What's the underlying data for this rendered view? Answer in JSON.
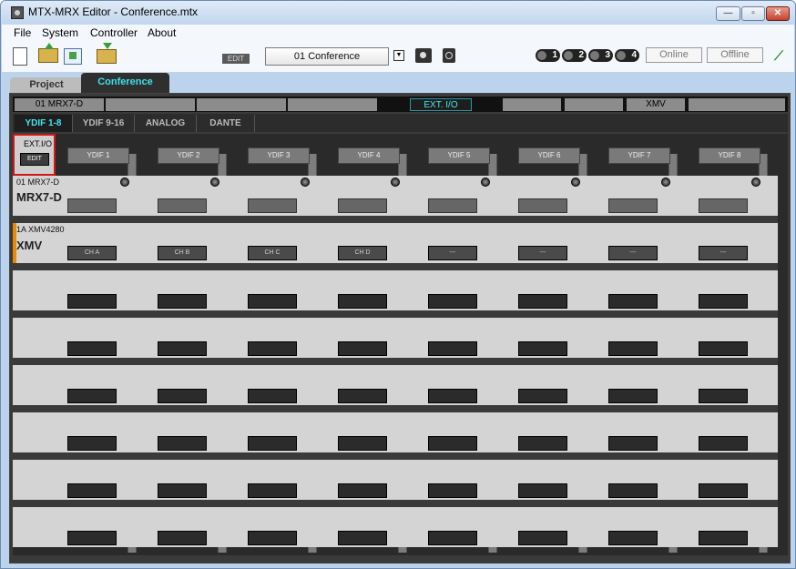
{
  "window": {
    "title": "MTX-MRX Editor - Conference.mtx"
  },
  "menu": [
    "File",
    "System",
    "Controller",
    "About"
  ],
  "toolbar": {
    "edit_label": "EDIT",
    "preset": "01 Conference",
    "leds": [
      "1",
      "2",
      "3",
      "4"
    ],
    "online": "Online",
    "offline": "Offline"
  },
  "tabs": {
    "project": "Project",
    "conference": "Conference"
  },
  "device_tabs": [
    "01 MRX7-D",
    "",
    "",
    "",
    "EXT. I/O",
    "",
    "",
    "XMV",
    ""
  ],
  "section_tabs": [
    "YDIF 1-8",
    "YDIF 9-16",
    "ANALOG",
    "DANTE"
  ],
  "ext_io": {
    "label": "EXT.I/O",
    "edit": "EDIT"
  },
  "columns": [
    "YDIF 1",
    "YDIF 2",
    "YDIF 3",
    "YDIF 4",
    "YDIF 5",
    "YDIF 6",
    "YDIF 7",
    "YDIF 8"
  ],
  "rows": [
    {
      "id": "01 MRX7-D",
      "name": "MRX7-D"
    },
    {
      "id": "1A XMV4280",
      "name": "XMV",
      "cells": [
        "CH A",
        "CH B",
        "CH C",
        "CH D",
        "---",
        "---",
        "---",
        "---"
      ]
    }
  ]
}
